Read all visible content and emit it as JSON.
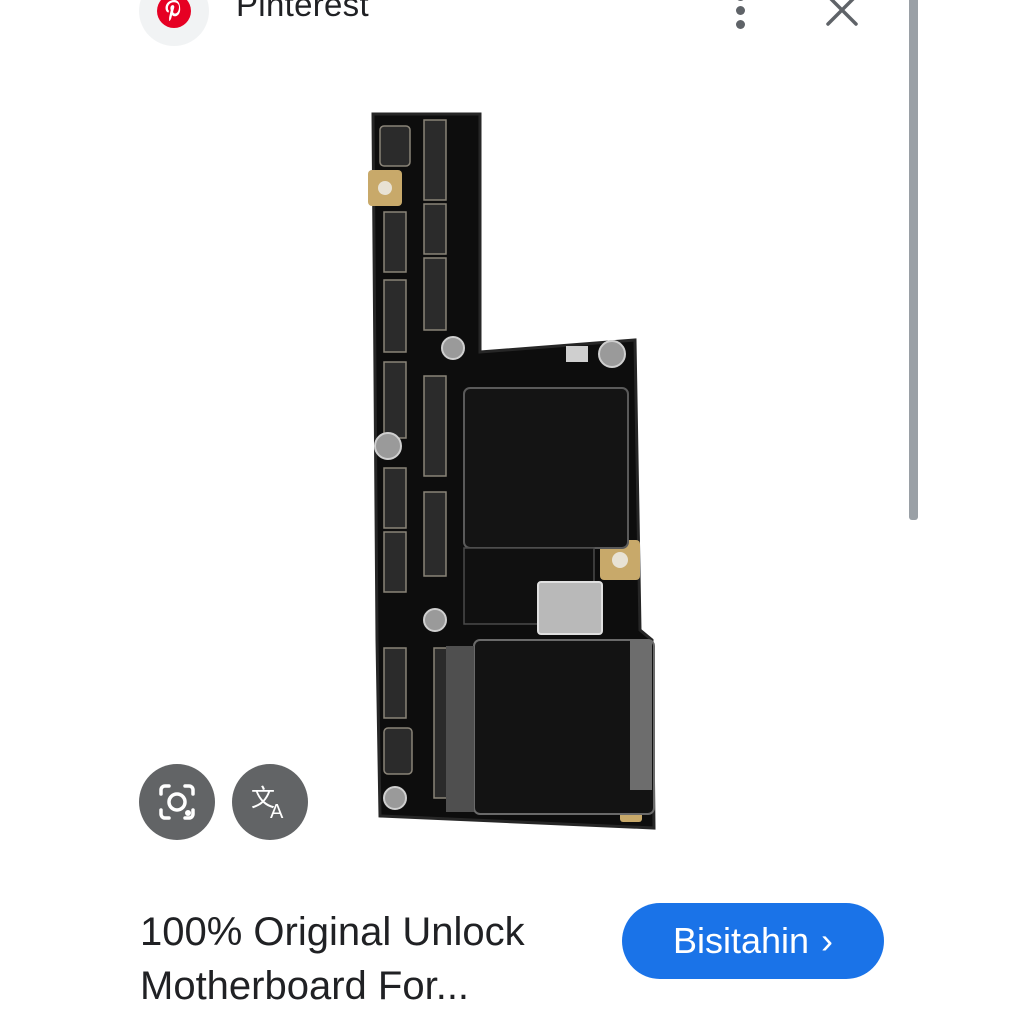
{
  "source": {
    "name": "Pinterest",
    "brand_color": "#e60023",
    "icons": {
      "logo": "pinterest-logo",
      "more": "more-vertical-icon",
      "close": "close-icon"
    }
  },
  "image": {
    "subject": "phone logic board",
    "icon": "product-image"
  },
  "overlay_actions": {
    "lens_icon": "google-lens-icon",
    "translate_icon": "translate-icon"
  },
  "result": {
    "title_line1": "100% Original Unlock",
    "title_line2": "Motherboard For...",
    "visit_label": "Bisitahin",
    "visit_chevron": "›",
    "accent_color": "#1a73e8"
  }
}
